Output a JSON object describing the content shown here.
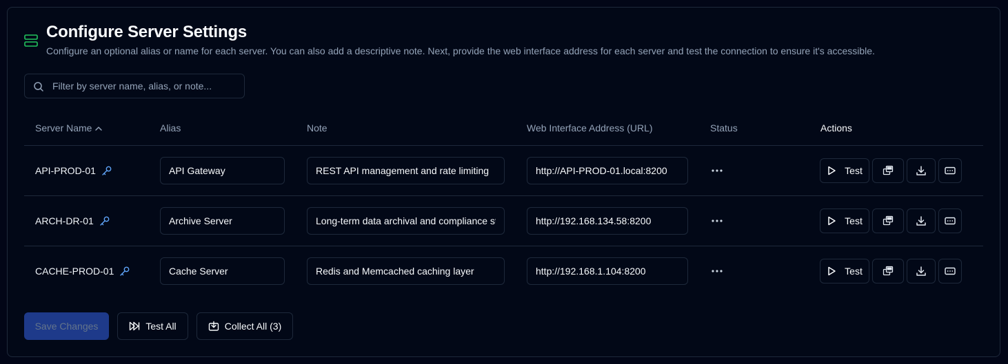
{
  "header": {
    "title": "Configure Server Settings",
    "subtitle": "Configure an optional alias or name for each server. You can also add a descriptive note. Next, provide the web interface address for each server and test the connection to ensure it's accessible.",
    "icon": "server-icon",
    "accent_color": "#22c55e"
  },
  "search": {
    "placeholder": "Filter by server name, alias, or note...",
    "value": ""
  },
  "table": {
    "columns": {
      "server_name": "Server Name",
      "alias": "Alias",
      "note": "Note",
      "url": "Web Interface Address (URL)",
      "status": "Status",
      "actions": "Actions"
    },
    "sort": {
      "column": "server_name",
      "direction": "ascending"
    },
    "rows": [
      {
        "server_name": "API-PROD-01",
        "alias": "API Gateway",
        "note": "REST API management and rate limiting",
        "url": "http://API-PROD-01.local:8200",
        "status": "pending",
        "test_label": "Test"
      },
      {
        "server_name": "ARCH-DR-01",
        "alias": "Archive Server",
        "note": "Long-term data archival and compliance storage",
        "url": "http://192.168.134.58:8200",
        "status": "pending",
        "test_label": "Test"
      },
      {
        "server_name": "CACHE-PROD-01",
        "alias": "Cache Server",
        "note": "Redis and Memcached caching layer",
        "url": "http://192.168.1.104:8200",
        "status": "pending",
        "test_label": "Test"
      }
    ]
  },
  "footer": {
    "save_label": "Save Changes",
    "test_all_label": "Test All",
    "collect_all_label": "Collect All (3)"
  },
  "colors": {
    "background": "#020617",
    "border": "#1e293b",
    "muted_text": "#94a3b8",
    "key_icon": "#60a5fa",
    "save_button": "#1e3a8a"
  }
}
